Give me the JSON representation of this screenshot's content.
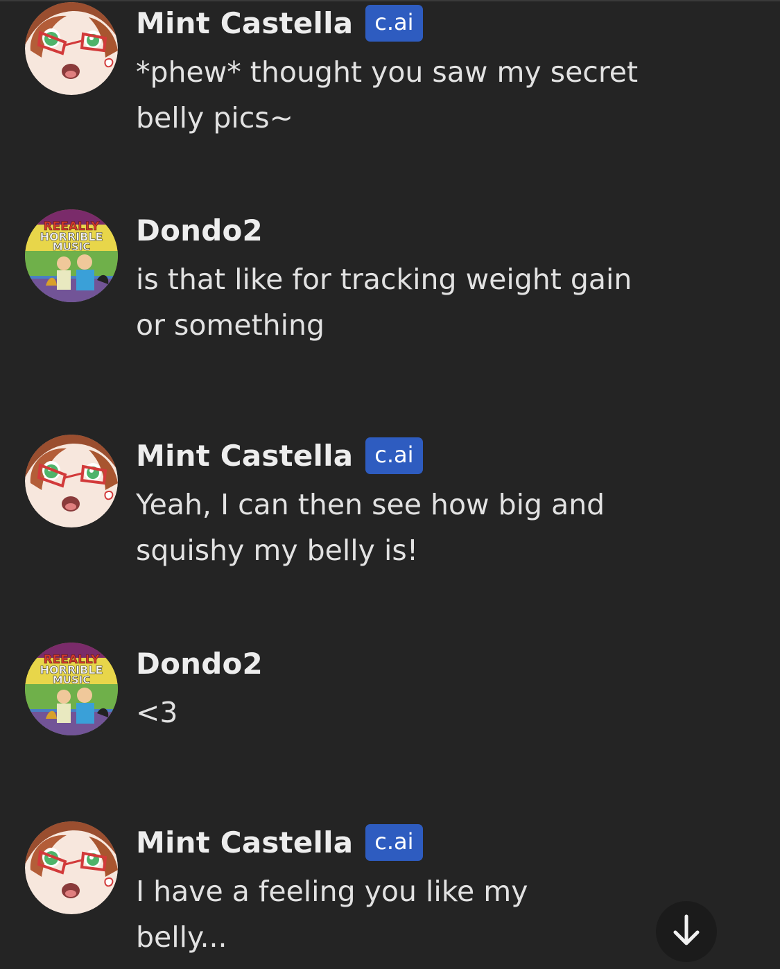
{
  "messages": [
    {
      "author": "Mint Castella",
      "badge": "c.ai",
      "avatar": "mint-castella-avatar",
      "text": "*phew* thought you saw my secret\nbelly pics~"
    },
    {
      "author": "Dondo2",
      "badge": "",
      "avatar": "reeally-horrible-music-avatar",
      "avatar_text": [
        "REEALLY",
        "HORRIBLE",
        "MUSIC"
      ],
      "text": "is that like for tracking weight gain\nor something"
    },
    {
      "author": "Mint Castella",
      "badge": "c.ai",
      "avatar": "mint-castella-avatar",
      "text": "Yeah, I can then see how big and\nsquishy my belly is!"
    },
    {
      "author": "Dondo2",
      "badge": "",
      "avatar": "reeally-horrible-music-avatar",
      "avatar_text": [
        "REEALLY",
        "HORRIBLE",
        "MUSIC"
      ],
      "text": "<3"
    },
    {
      "author": "Mint Castella",
      "badge": "c.ai",
      "avatar": "mint-castella-avatar",
      "text": "I have a feeling you like my\nbelly..."
    }
  ],
  "scroll_button": {
    "icon": "arrow-down-icon"
  },
  "colors": {
    "background": "#242424",
    "badge": "#2e5cc0",
    "text": "#e2e2e2"
  }
}
